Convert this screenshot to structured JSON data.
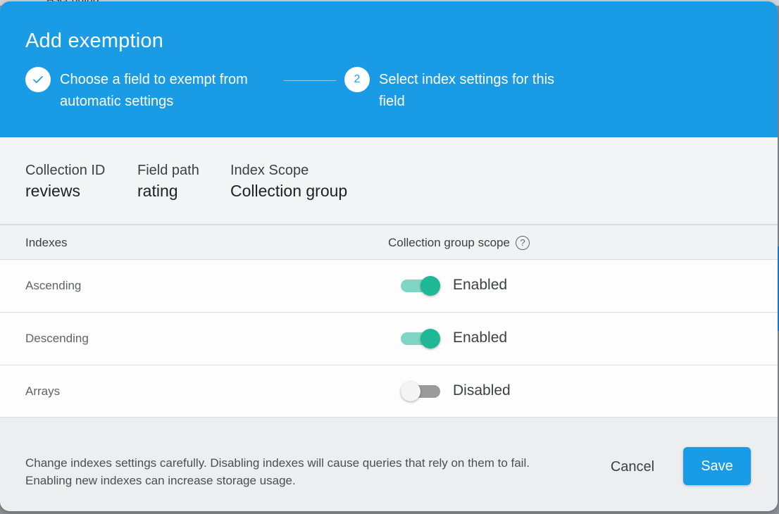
{
  "background": {
    "partial_text": "Ascending"
  },
  "dialog": {
    "title": "Add exemption",
    "steps": [
      {
        "number": "",
        "label": "Choose a field to exempt from automatic settings",
        "status": "complete"
      },
      {
        "number": "2",
        "label": "Select index settings for this field",
        "status": "active"
      }
    ],
    "fields": [
      {
        "label": "Collection ID",
        "value": "reviews"
      },
      {
        "label": "Field path",
        "value": "rating"
      },
      {
        "label": "Index Scope",
        "value": "Collection group"
      }
    ],
    "table": {
      "headers": {
        "indexes": "Indexes",
        "scope": "Collection group scope"
      },
      "rows": [
        {
          "name": "Ascending",
          "state": "Enabled",
          "enabled": true
        },
        {
          "name": "Descending",
          "state": "Enabled",
          "enabled": true
        },
        {
          "name": "Arrays",
          "state": "Disabled",
          "enabled": false
        }
      ]
    },
    "footer": {
      "note_line1": "Change indexes settings carefully. Disabling indexes will cause queries that rely on them to fail.",
      "note_line2": "Enabling new indexes can increase storage usage.",
      "cancel_label": "Cancel",
      "save_label": "Save"
    }
  },
  "colors": {
    "header": "#1a9be6",
    "toggle_on": "#1eb896",
    "toggle_track_on": "#7fd6c4",
    "toggle_off": "#9a9a9a"
  },
  "icons": {
    "step_complete": "check-icon",
    "help": "help-circle-icon"
  }
}
